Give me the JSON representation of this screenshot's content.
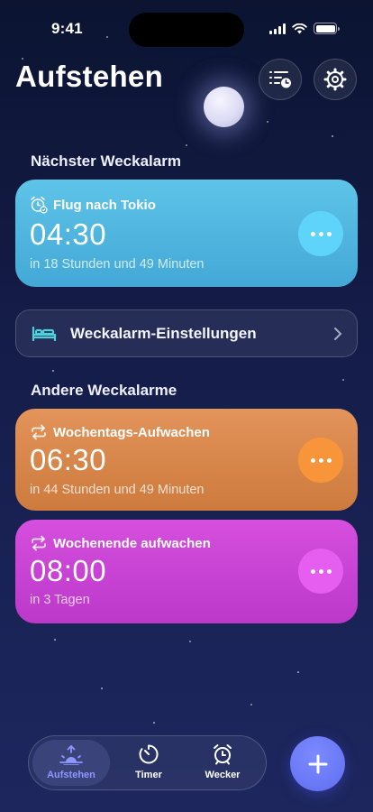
{
  "status_bar": {
    "time": "9:41"
  },
  "header": {
    "title": "Aufstehen"
  },
  "sections": {
    "next_alarm": "Nächster Weckalarm",
    "other_alarms": "Andere Weckalarme"
  },
  "next_alarm": {
    "label": "Flug nach Tokio",
    "time": "04:30",
    "subtitle": "in 18 Stunden und 49 Minuten",
    "color": "#4fb6e0"
  },
  "settings_row": {
    "label": "Weckalarm-Einstellungen"
  },
  "other_alarms": [
    {
      "label": "Wochentags-Aufwachen",
      "time": "06:30",
      "subtitle": "in 44 Stunden und 49 Minuten",
      "color": "#d9874a"
    },
    {
      "label": "Wochenende aufwachen",
      "time": "08:00",
      "subtitle": "in 3 Tagen",
      "color": "#cb45d6"
    }
  ],
  "tabs": [
    {
      "label": "Aufstehen",
      "icon": "sunrise-icon",
      "active": true
    },
    {
      "label": "Timer",
      "icon": "timer-icon",
      "active": false
    },
    {
      "label": "Wecker",
      "icon": "alarm-clock-icon",
      "active": false
    }
  ],
  "colors": {
    "accent": "#6f7cf7",
    "background": "#141c48",
    "active_tab": "#8d97ff"
  }
}
